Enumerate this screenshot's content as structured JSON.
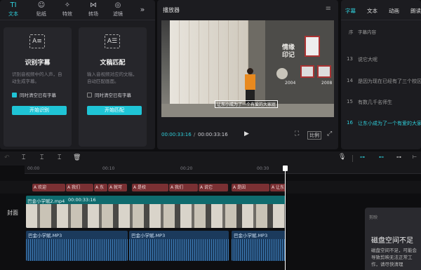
{
  "toolbar": {
    "items": [
      {
        "icon": "TI",
        "label": "文本"
      },
      {
        "icon": "☺",
        "label": "贴纸"
      },
      {
        "icon": "✧",
        "label": "特效"
      },
      {
        "icon": "⋈",
        "label": "转场"
      },
      {
        "icon": "◎",
        "label": "滤镜"
      }
    ],
    "more": "»"
  },
  "cards": {
    "auto": {
      "title": "识别字幕",
      "desc": "识别音视频中的人声，自动生成字幕。",
      "check": "同时清空已有字幕",
      "button": "开始识别"
    },
    "match": {
      "title": "文稿匹配",
      "desc": "输入音视频对应的文稿，自动匹配画面。",
      "check": "同时清空已有字幕",
      "button": "开始匹配"
    }
  },
  "player": {
    "title": "播放器",
    "menu": "≡",
    "subtitle": "让东小成为了一个有爱的大家庭",
    "sign_text": "情缘印记",
    "year1": "2004",
    "year2": "2008",
    "current": "00:00:33:16",
    "total": "00:00:33:16",
    "ratio": "比例"
  },
  "right": {
    "tabs": [
      "字幕",
      "文本",
      "动画",
      "朗读"
    ],
    "col_index": "序",
    "col_content": "字幕内容",
    "rows": [
      {
        "n": "13",
        "t": "说它大呢"
      },
      {
        "n": "14",
        "t": "是因为现在已经有了三个校区"
      },
      {
        "n": "15",
        "t": "有数几千名师生"
      },
      {
        "n": "16",
        "t": "让东小成为了一个有爱的大家庭"
      }
    ]
  },
  "timeline": {
    "ticks": [
      "00:00",
      "00:10",
      "00:20",
      "00:30"
    ],
    "subs": [
      "A 欢迎",
      "A 我们",
      "A 东",
      "A 就可",
      "A 是校",
      "A 我们",
      "A 说它",
      "A 是因",
      "A 让东"
    ],
    "video": {
      "name": "巴金小学赋2.mp4",
      "dur": "00:00:33:16",
      "cover": "封面"
    },
    "audio": [
      "巴金小学赋.MP3",
      "巴金小学赋.MP3",
      "巴金小学赋.MP3"
    ]
  },
  "warning": {
    "header": "剪映",
    "title": "磁盘空间不足",
    "body": "磁盘空间不足，可能会导致剪映无法正常工作，请尽快清理"
  }
}
